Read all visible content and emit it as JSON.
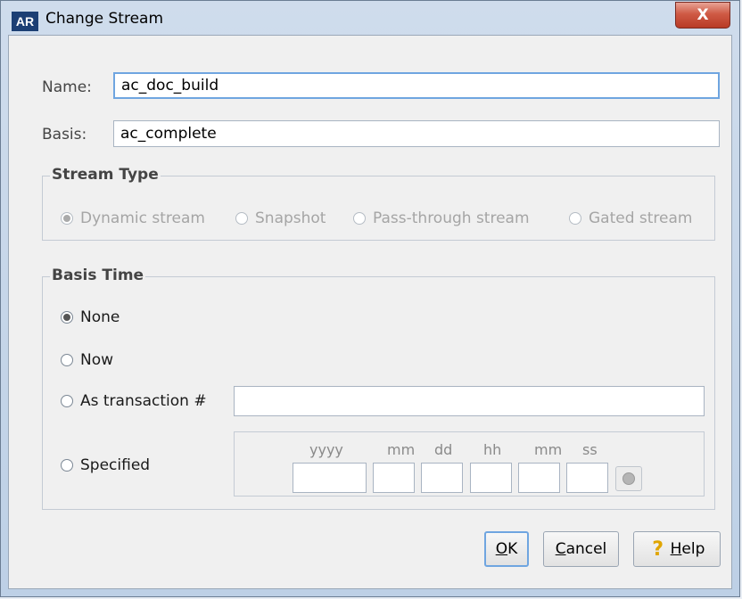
{
  "window": {
    "app_icon": "AR",
    "title": "Change Stream",
    "close_label": "X"
  },
  "form": {
    "name_label": "Name:",
    "name_value": "ac_doc_build",
    "basis_label": "Basis:",
    "basis_value": "ac_complete"
  },
  "stream_type": {
    "title": "Stream Type",
    "options": [
      {
        "label": "Dynamic stream",
        "selected": true
      },
      {
        "label": "Snapshot",
        "selected": false
      },
      {
        "label": "Pass-through stream",
        "selected": false
      },
      {
        "label": "Gated stream",
        "selected": false
      }
    ]
  },
  "basis_time": {
    "title": "Basis Time",
    "options": [
      {
        "label": "None",
        "selected": true
      },
      {
        "label": "Now",
        "selected": false
      },
      {
        "label": "As transaction #",
        "selected": false
      },
      {
        "label": "Specified",
        "selected": false
      }
    ],
    "transaction_value": "",
    "date_labels": [
      "yyyy",
      "mm",
      "dd",
      "hh",
      "mm",
      "ss"
    ]
  },
  "buttons": {
    "ok_mnemonic": "O",
    "ok_rest": "K",
    "cancel_mnemonic": "C",
    "cancel_rest": "ancel",
    "help_mnemonic": "H",
    "help_rest": "elp",
    "help_icon": "?"
  },
  "colors": {
    "focus": "#6fa5e0",
    "close": "#c94a35",
    "app_icon_bg": "#1c3f74"
  }
}
